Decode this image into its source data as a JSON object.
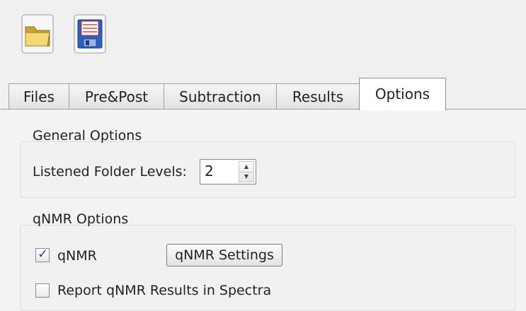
{
  "toolbar": {
    "open_icon": "folder-open-icon",
    "save_icon": "floppy-save-icon"
  },
  "tabs": [
    {
      "label": "Files"
    },
    {
      "label": "Pre&Post"
    },
    {
      "label": "Subtraction"
    },
    {
      "label": "Results"
    },
    {
      "label": "Options",
      "active": true
    }
  ],
  "general": {
    "title": "General Options",
    "folder_levels_label": "Listened Folder Levels:",
    "folder_levels_value": "2",
    "spin_up": "▲",
    "spin_down": "▼"
  },
  "qnmr": {
    "title": "qNMR Options",
    "qnmr_label": "qNMR",
    "qnmr_checked": true,
    "settings_button": "qNMR Settings",
    "report_label": "Report qNMR Results in Spectra",
    "report_checked": false,
    "check_glyph": "✓"
  },
  "colors": {
    "folder": "#e8c65a",
    "floppy": "#2f5fbf",
    "active_tab": "#ffffff",
    "panel": "#f3f3f3"
  }
}
